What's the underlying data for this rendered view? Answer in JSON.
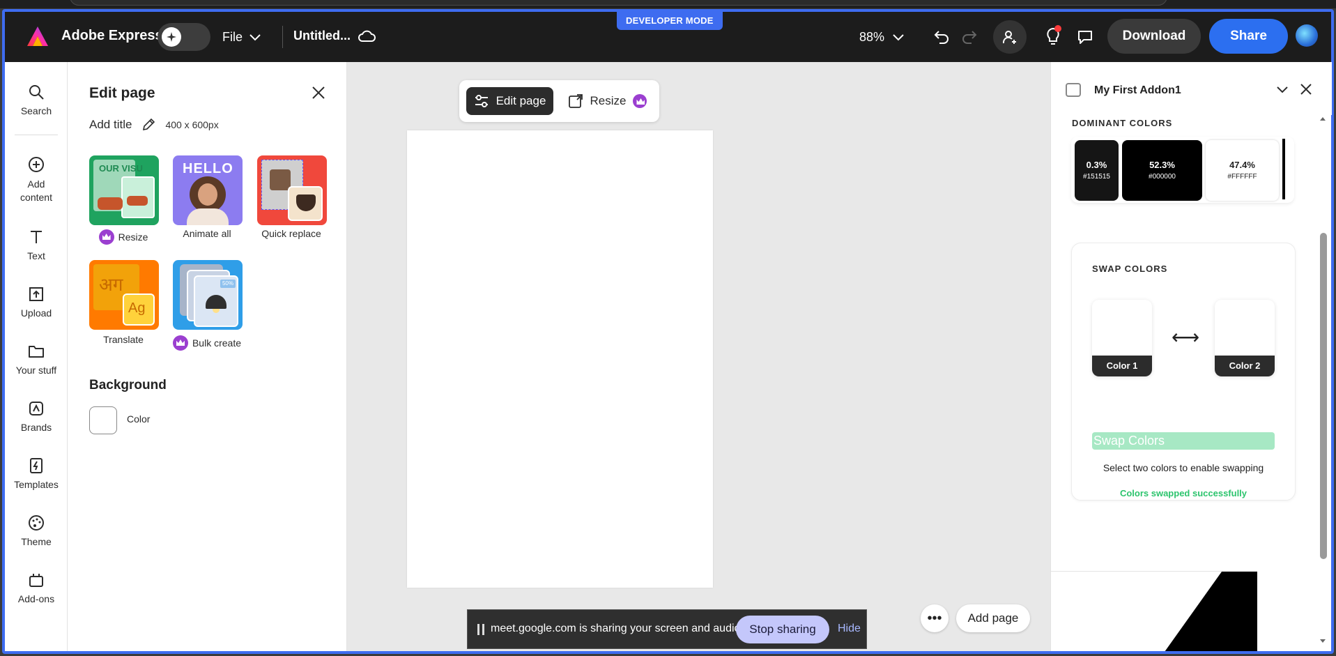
{
  "topbar": {
    "dev_badge": "DEVELOPER MODE",
    "brand": "Adobe Express",
    "file_label": "File",
    "doc_title": "Untitled...",
    "zoom": "88%",
    "download_label": "Download",
    "share_label": "Share",
    "share_color": "#2c6ff0"
  },
  "leftrail": {
    "items": [
      {
        "label": "Search",
        "icon": "search-icon"
      },
      {
        "label": "Add content",
        "icon": "plus-circle-icon"
      },
      {
        "label": "Text",
        "icon": "text-icon"
      },
      {
        "label": "Upload",
        "icon": "upload-icon"
      },
      {
        "label": "Your stuff",
        "icon": "folder-icon"
      },
      {
        "label": "Brands",
        "icon": "brand-icon"
      },
      {
        "label": "Templates",
        "icon": "templates-icon"
      },
      {
        "label": "Theme",
        "icon": "palette-icon"
      },
      {
        "label": "Add-ons",
        "icon": "addons-icon"
      }
    ]
  },
  "edit_panel": {
    "title": "Edit page",
    "add_title": "Add title",
    "dimensions": "400 x 600px",
    "tiles": [
      {
        "label": "Resize",
        "premium": true
      },
      {
        "label": "Animate all",
        "premium": false
      },
      {
        "label": "Quick replace",
        "premium": false
      },
      {
        "label": "Translate",
        "premium": false
      },
      {
        "label": "Bulk create",
        "premium": true
      }
    ],
    "tile_texts": {
      "resize_art": "OUR VISU",
      "animate_art": "HELLO",
      "translate_hindi": "अग",
      "translate_latin": "Ag",
      "bulk_badge": "50%"
    },
    "background_title": "Background",
    "background_color_label": "Color"
  },
  "canvas": {
    "edit_page_label": "Edit page",
    "resize_label": "Resize",
    "add_page_label": "Add page",
    "more_label": "•••"
  },
  "share_bar": {
    "message": "meet.google.com is sharing your screen and audio.",
    "stop_label": "Stop sharing",
    "hide_label": "Hide"
  },
  "addon_panel": {
    "title": "My First Addon1",
    "dominant_title": "DOMINANT COLORS",
    "swatches": [
      {
        "pct": "0.3%",
        "hex": "#151515",
        "bg": "#151515",
        "fg": "#ffffff"
      },
      {
        "pct": "52.3%",
        "hex": "#000000",
        "bg": "#000000",
        "fg": "#ffffff"
      },
      {
        "pct": "47.4%",
        "hex": "#FFFFFF",
        "bg": "#ffffff",
        "fg": "#222222"
      }
    ],
    "swap_title": "SWAP COLORS",
    "color1_label": "Color 1",
    "color2_label": "Color 2",
    "swap_arrow": "⟷",
    "swap_button": "Swap Colors",
    "hint": "Select two colors to enable swapping",
    "success": "Colors swapped successfully"
  }
}
